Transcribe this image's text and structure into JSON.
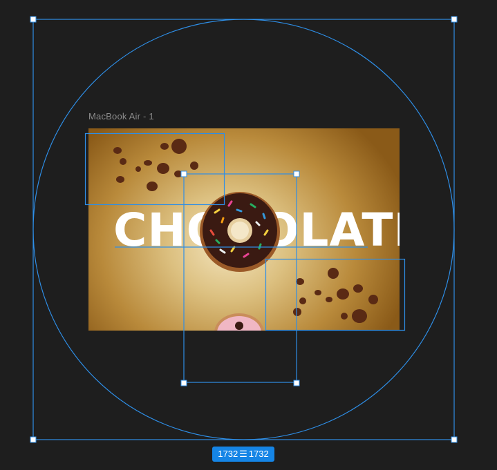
{
  "frame": {
    "label": "MacBook Air - 1"
  },
  "artboard": {
    "headline": "CHOCOLATE"
  },
  "selection": {
    "width_label": "1732",
    "height_label": "1732",
    "separator_icon": "equal-bars-icon",
    "accent_color": "#2e8ee6"
  },
  "colors": {
    "canvas_background": "#1e1e1e",
    "badge_background": "#1585e6",
    "donut_glaze": "#3a1a12",
    "donut_dough": "#9b5a28"
  }
}
